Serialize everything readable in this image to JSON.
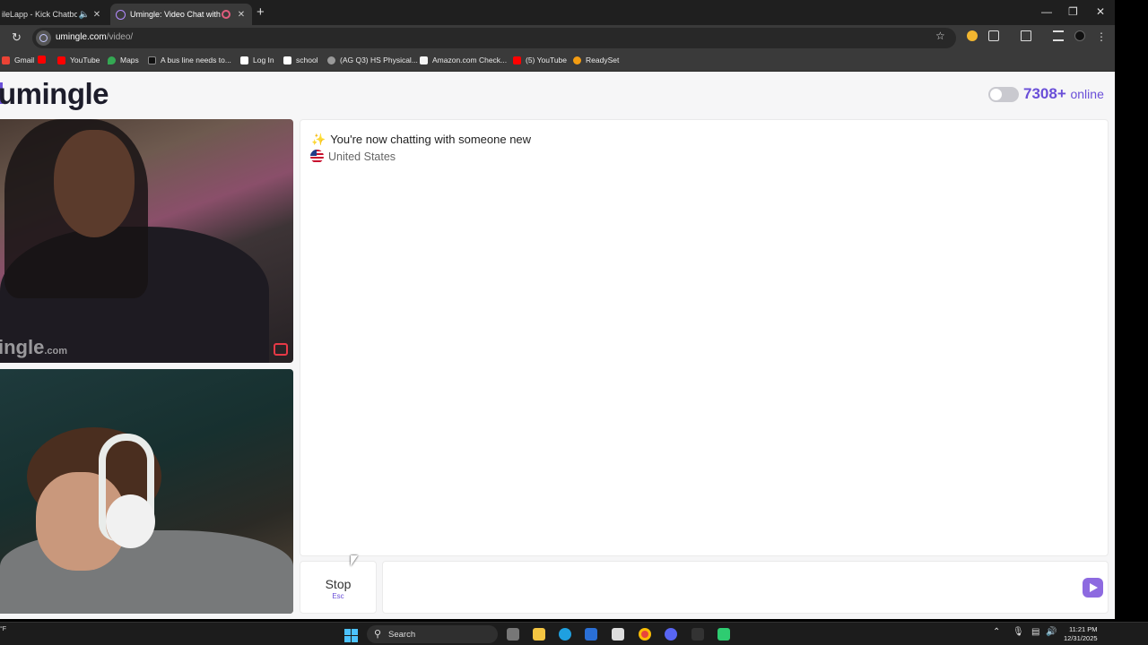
{
  "browser": {
    "tabs": [
      {
        "title": "ileLapp - Kick Chatbot a",
        "active": false
      },
      {
        "title": "Umingle: Video Chat with S",
        "active": true
      }
    ],
    "url_host": "umingle.com",
    "url_path": "/video/",
    "bookmarks": [
      "Gmail",
      "",
      "YouTube",
      "Maps",
      "A bus line needs to...",
      "Log In",
      "school",
      "(AG Q3) HS Physical...",
      "Amazon.com Check...",
      "(5) YouTube",
      "ReadySet"
    ]
  },
  "page": {
    "logo": "umingle",
    "online_count": "7308+",
    "online_label": "online",
    "remote_watermark": "ingle",
    "remote_watermark_suffix": ".com",
    "chat": {
      "system_message": "You're now chatting with someone new",
      "country": "United States"
    },
    "stop_button": {
      "label": "Stop",
      "shortcut": "Esc"
    },
    "message_input": {
      "placeholder": ""
    }
  },
  "taskbar": {
    "left_text": "°F",
    "search_label": "Search",
    "time": "11:21 PM",
    "date": "12/31/2025"
  },
  "colors": {
    "accent": "#6a4fd8",
    "send_button": "#8d6ae0",
    "flag_red": "#e63946"
  }
}
